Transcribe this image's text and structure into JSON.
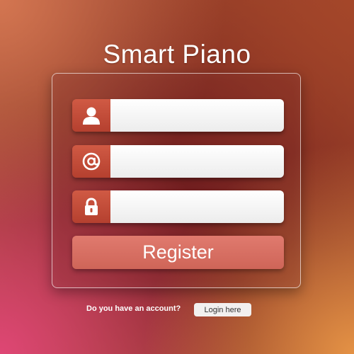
{
  "app": {
    "title": "Smart Piano"
  },
  "form": {
    "fields": [
      {
        "icon": "user-icon",
        "value": "",
        "placeholder": ""
      },
      {
        "icon": "at-sign-icon",
        "value": "",
        "placeholder": ""
      },
      {
        "icon": "lock-icon",
        "value": "",
        "placeholder": ""
      }
    ],
    "register_label": "Register"
  },
  "footer": {
    "prompt": "Do you have an account?",
    "login_label": "Login here"
  },
  "colors": {
    "accent": "#c24b37",
    "button": "#d76f62",
    "background": "#7a2520"
  }
}
